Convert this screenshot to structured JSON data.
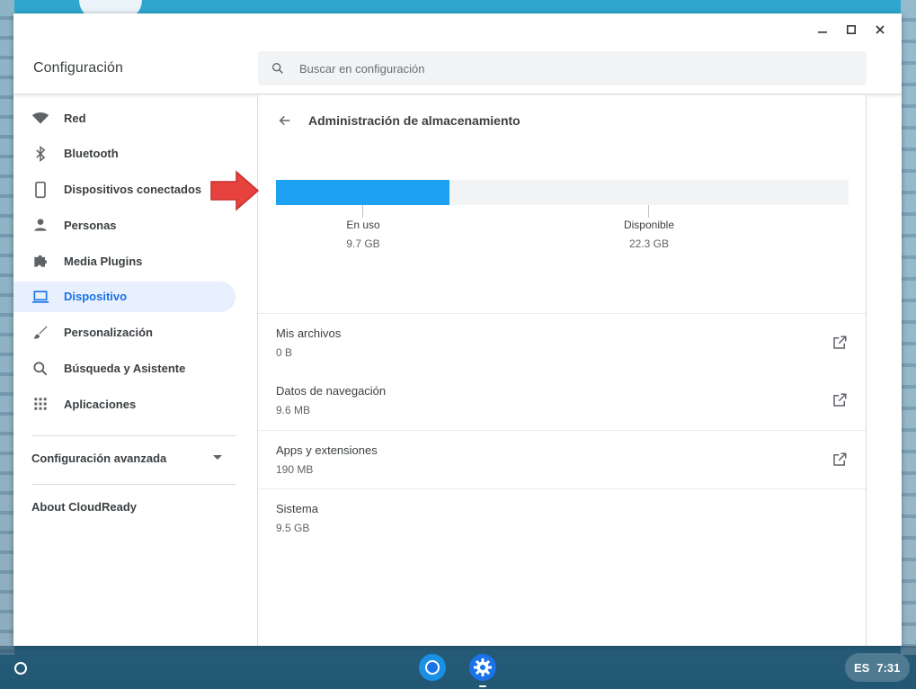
{
  "window": {
    "title": "Configuración",
    "controls": {
      "minimize": "minimize-icon",
      "maximize": "maximize-icon",
      "close": "close-icon"
    }
  },
  "search": {
    "placeholder": "Buscar en configuración"
  },
  "sidebar": {
    "items": [
      {
        "label": "Red",
        "icon": "wifi-icon"
      },
      {
        "label": "Bluetooth",
        "icon": "bluetooth-icon"
      },
      {
        "label": "Dispositivos conectados",
        "icon": "phone-icon"
      },
      {
        "label": "Personas",
        "icon": "person-icon"
      },
      {
        "label": "Media Plugins",
        "icon": "puzzle-icon"
      },
      {
        "label": "Dispositivo",
        "icon": "laptop-icon",
        "active": true
      },
      {
        "label": "Personalización",
        "icon": "brush-icon"
      },
      {
        "label": "Búsqueda y Asistente",
        "icon": "search-icon"
      },
      {
        "label": "Aplicaciones",
        "icon": "apps-grid-icon"
      }
    ],
    "advanced_label": "Configuración avanzada",
    "about_label": "About CloudReady"
  },
  "main": {
    "title": "Administración de almacenamiento",
    "storage": {
      "used_label": "En uso",
      "used_value": "9.7 GB",
      "available_label": "Disponible",
      "available_value": "22.3 GB",
      "used_fraction": 0.303
    },
    "rows": [
      {
        "title": "Mis archivos",
        "size": "0 B",
        "external": true
      },
      {
        "title": "Datos de navegación",
        "size": "9.6 MB",
        "external": true
      },
      {
        "title": "Apps y extensiones",
        "size": "190 MB",
        "external": true
      },
      {
        "title": "Sistema",
        "size": "9.5 GB",
        "external": false
      }
    ]
  },
  "shelf": {
    "apps": [
      "chrome-icon",
      "settings-icon"
    ],
    "language": "ES",
    "time": "7:31"
  },
  "colors": {
    "accent": "#1a73e8",
    "bar_fill": "#1da1f2",
    "arrow": "#e8423f"
  }
}
